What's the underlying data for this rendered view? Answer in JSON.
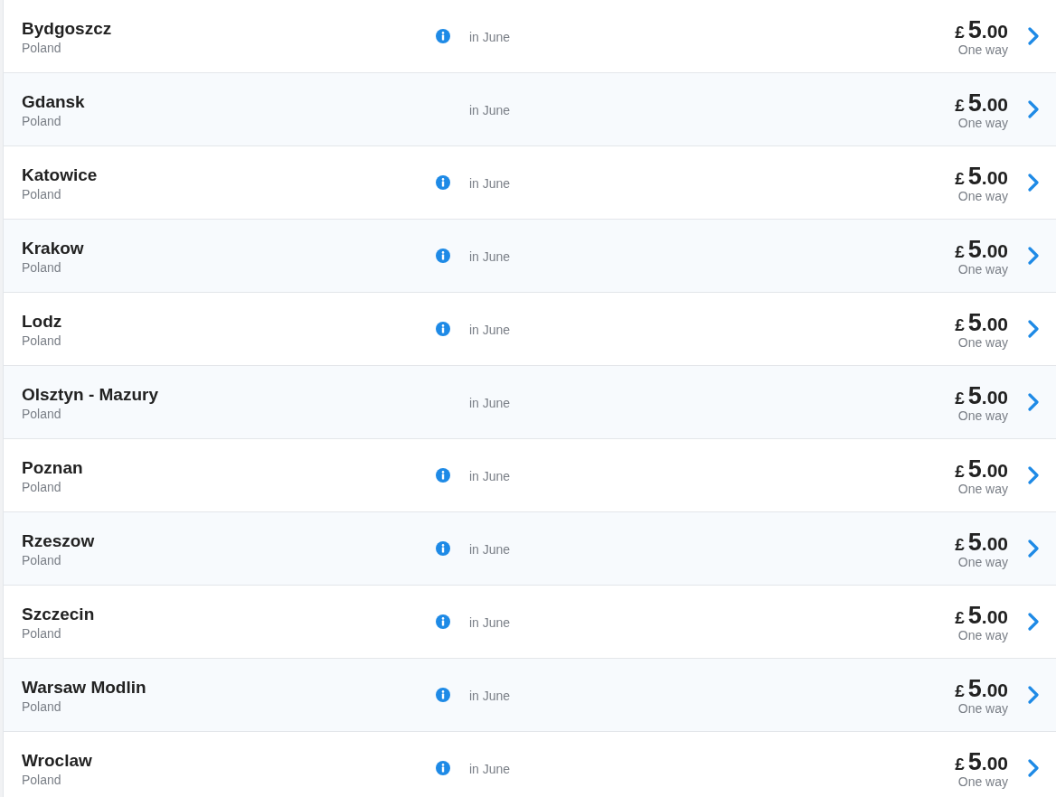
{
  "destinations": [
    {
      "city": "Bydgoszcz",
      "country": "Poland",
      "info": true,
      "when": "in June",
      "currency": "£",
      "amount": "5",
      "fraction": ".00",
      "trip": "One way"
    },
    {
      "city": "Gdansk",
      "country": "Poland",
      "info": false,
      "when": "in June",
      "currency": "£",
      "amount": "5",
      "fraction": ".00",
      "trip": "One way"
    },
    {
      "city": "Katowice",
      "country": "Poland",
      "info": true,
      "when": "in June",
      "currency": "£",
      "amount": "5",
      "fraction": ".00",
      "trip": "One way"
    },
    {
      "city": "Krakow",
      "country": "Poland",
      "info": true,
      "when": "in June",
      "currency": "£",
      "amount": "5",
      "fraction": ".00",
      "trip": "One way"
    },
    {
      "city": "Lodz",
      "country": "Poland",
      "info": true,
      "when": "in June",
      "currency": "£",
      "amount": "5",
      "fraction": ".00",
      "trip": "One way"
    },
    {
      "city": "Olsztyn - Mazury",
      "country": "Poland",
      "info": false,
      "when": "in June",
      "currency": "£",
      "amount": "5",
      "fraction": ".00",
      "trip": "One way"
    },
    {
      "city": "Poznan",
      "country": "Poland",
      "info": true,
      "when": "in June",
      "currency": "£",
      "amount": "5",
      "fraction": ".00",
      "trip": "One way"
    },
    {
      "city": "Rzeszow",
      "country": "Poland",
      "info": true,
      "when": "in June",
      "currency": "£",
      "amount": "5",
      "fraction": ".00",
      "trip": "One way"
    },
    {
      "city": "Szczecin",
      "country": "Poland",
      "info": true,
      "when": "in June",
      "currency": "£",
      "amount": "5",
      "fraction": ".00",
      "trip": "One way"
    },
    {
      "city": "Warsaw Modlin",
      "country": "Poland",
      "info": true,
      "when": "in June",
      "currency": "£",
      "amount": "5",
      "fraction": ".00",
      "trip": "One way"
    },
    {
      "city": "Wroclaw",
      "country": "Poland",
      "info": true,
      "when": "in June",
      "currency": "£",
      "amount": "5",
      "fraction": ".00",
      "trip": "One way"
    }
  ]
}
